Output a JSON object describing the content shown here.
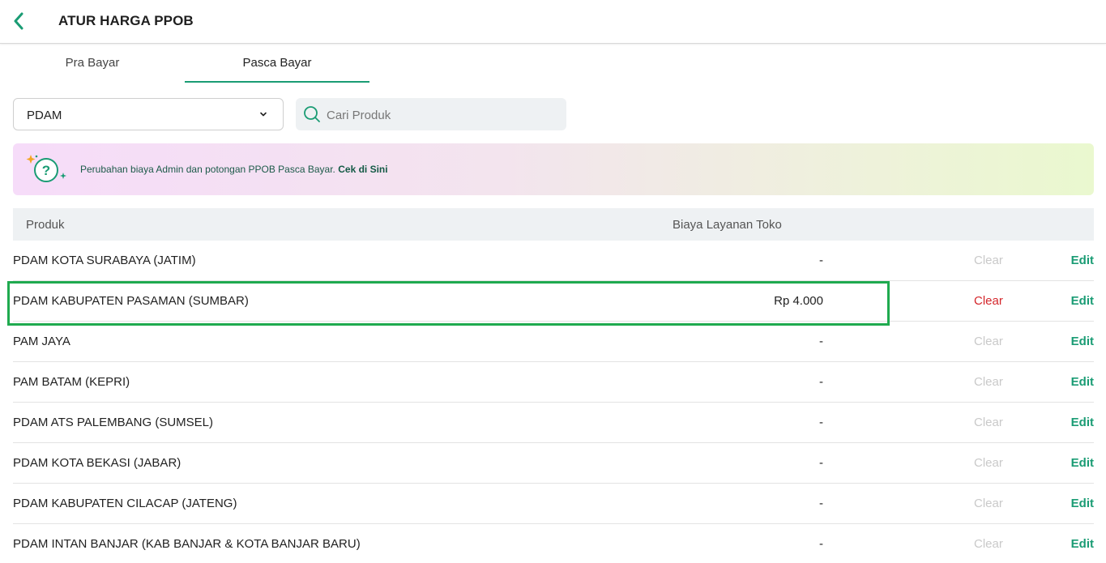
{
  "header": {
    "title": "ATUR HARGA PPOB",
    "back_icon": "chevron-left-icon",
    "accent": "#1a9c74"
  },
  "tabs": [
    {
      "label": "Pra Bayar",
      "active": false
    },
    {
      "label": "Pasca Bayar",
      "active": true
    }
  ],
  "filter": {
    "selected": "PDAM"
  },
  "search": {
    "placeholder": "Cari Produk"
  },
  "banner": {
    "text": "Perubahan biaya Admin dan potongan PPOB Pasca Bayar.",
    "link": "Cek di Sini",
    "icon": "question-sparkle-icon"
  },
  "table": {
    "headers": {
      "product": "Produk",
      "fee": "Biaya Layanan Toko"
    },
    "rows": [
      {
        "name": "PDAM KOTA SURABAYA (JATIM)",
        "fee": "-",
        "clear": "Clear",
        "edit": "Edit",
        "clear_active": false
      },
      {
        "name": "PDAM KABUPATEN PASAMAN (SUMBAR)",
        "fee": "Rp 4.000",
        "clear": "Clear",
        "edit": "Edit",
        "clear_active": true
      },
      {
        "name": "PAM JAYA",
        "fee": "-",
        "clear": "Clear",
        "edit": "Edit",
        "clear_active": false
      },
      {
        "name": "PAM BATAM (KEPRI)",
        "fee": "-",
        "clear": "Clear",
        "edit": "Edit",
        "clear_active": false
      },
      {
        "name": "PDAM ATS PALEMBANG (SUMSEL)",
        "fee": "-",
        "clear": "Clear",
        "edit": "Edit",
        "clear_active": false
      },
      {
        "name": "PDAM KOTA BEKASI (JABAR)",
        "fee": "-",
        "clear": "Clear",
        "edit": "Edit",
        "clear_active": false
      },
      {
        "name": "PDAM KABUPATEN CILACAP (JATENG)",
        "fee": "-",
        "clear": "Clear",
        "edit": "Edit",
        "clear_active": false
      },
      {
        "name": "PDAM INTAN BANJAR (KAB BANJAR & KOTA BANJAR BARU)",
        "fee": "-",
        "clear": "Clear",
        "edit": "Edit",
        "clear_active": false
      }
    ]
  },
  "colors": {
    "clear_active": "#d4262b",
    "clear_disabled": "#c9c9c9",
    "highlight": "#1faa4f"
  }
}
